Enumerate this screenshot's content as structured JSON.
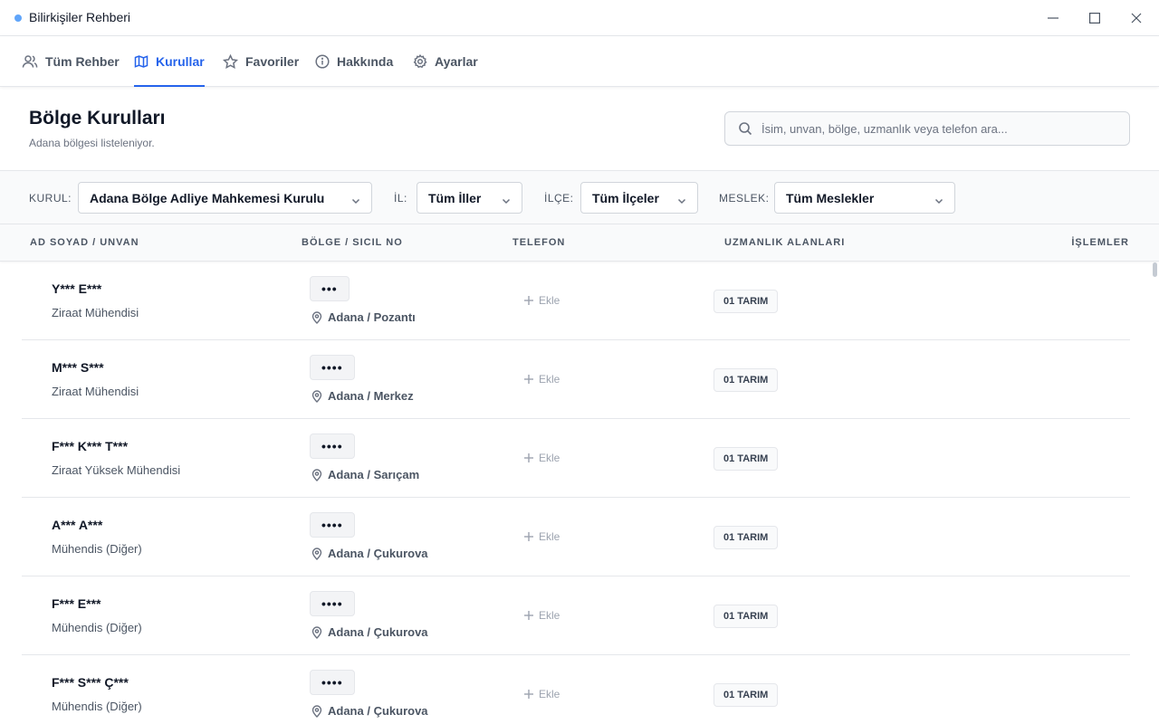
{
  "window": {
    "title": "Bilirkişiler Rehberi"
  },
  "nav": {
    "tabs": [
      {
        "label": "Tüm Rehber",
        "icon": "users-icon",
        "active": false
      },
      {
        "label": "Kurullar",
        "icon": "map-icon",
        "active": true
      },
      {
        "label": "Favoriler",
        "icon": "star-icon",
        "active": false
      },
      {
        "label": "Hakkında",
        "icon": "info-icon",
        "active": false
      },
      {
        "label": "Ayarlar",
        "icon": "gear-icon",
        "active": false
      }
    ]
  },
  "header": {
    "title": "Bölge Kurulları",
    "subtitle": "Adana bölgesi listeleniyor.",
    "search_placeholder": "İsim, unvan, bölge, uzmanlık veya telefon ara..."
  },
  "filters": {
    "kurul": {
      "label": "KURUL:",
      "value": "Adana Bölge Adliye Mahkemesi Kurulu"
    },
    "il": {
      "label": "İL:",
      "value": "Tüm İller"
    },
    "ilce": {
      "label": "İLÇE:",
      "value": "Tüm İlçeler"
    },
    "meslek": {
      "label": "MESLEK:",
      "value": "Tüm Meslekler"
    }
  },
  "table": {
    "columns": [
      "AD SOYAD / UNVAN",
      "BÖLGE / SICIL NO",
      "TELEFON",
      "UZMANLIK ALANLARI",
      "İŞLEMLER"
    ],
    "add_label": "Ekle",
    "rows": [
      {
        "name": "Y*** E***",
        "title": "Ziraat Mühendisi",
        "sicil": "•••",
        "location": "Adana / Pozantı",
        "tag": "01 TARIM"
      },
      {
        "name": "M*** S***",
        "title": "Ziraat Mühendisi",
        "sicil": "••••",
        "location": "Adana / Merkez",
        "tag": "01 TARIM"
      },
      {
        "name": "F*** K*** T***",
        "title": "Ziraat Yüksek Mühendisi",
        "sicil": "••••",
        "location": "Adana / Sarıçam",
        "tag": "01 TARIM"
      },
      {
        "name": "A*** A***",
        "title": "Mühendis (Diğer)",
        "sicil": "••••",
        "location": "Adana / Çukurova",
        "tag": "01 TARIM"
      },
      {
        "name": "F*** E***",
        "title": "Mühendis (Diğer)",
        "sicil": "••••",
        "location": "Adana / Çukurova",
        "tag": "01 TARIM"
      },
      {
        "name": "F*** S*** Ç***",
        "title": "Mühendis (Diğer)",
        "sicil": "••••",
        "location": "Adana / Çukurova",
        "tag": "01 TARIM"
      }
    ]
  },
  "colors": {
    "accent": "#2563eb",
    "title_dot": "#60a5fa"
  }
}
